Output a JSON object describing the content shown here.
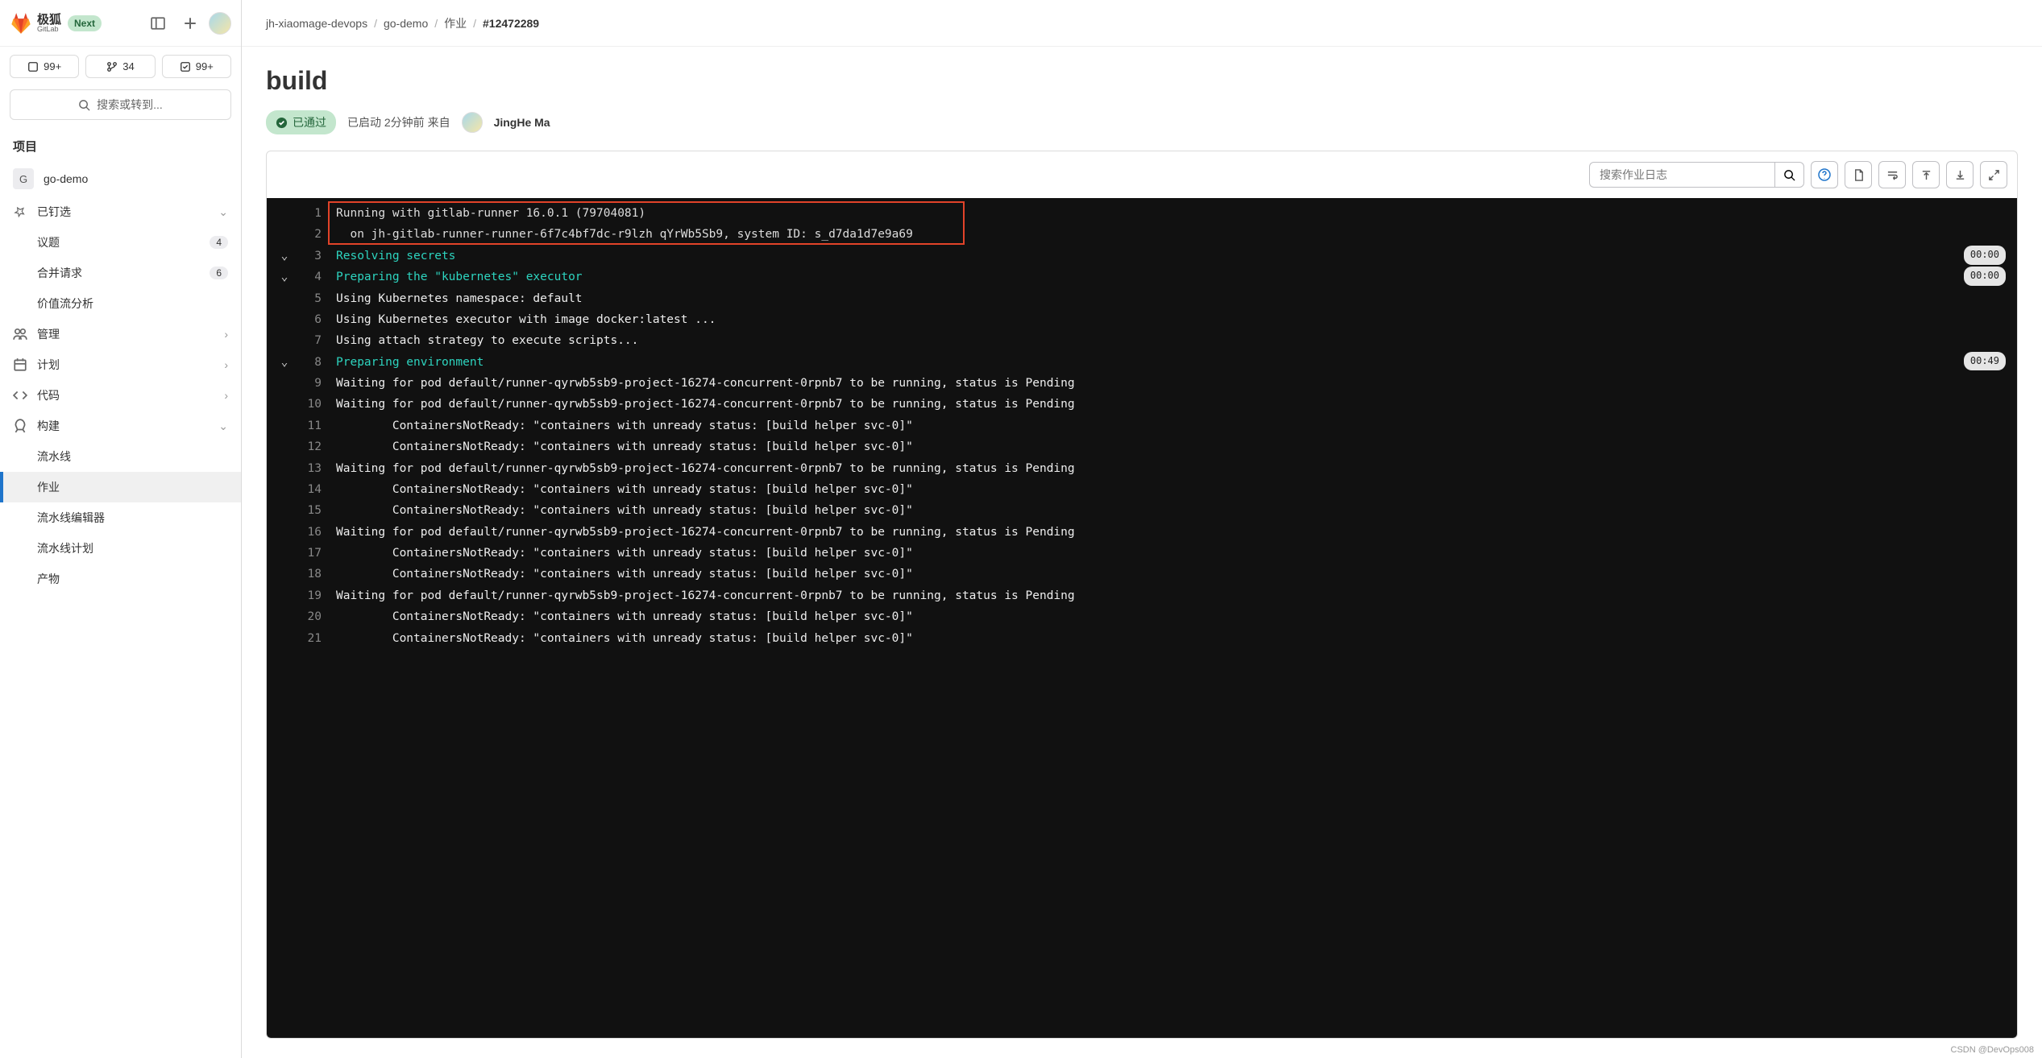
{
  "logo": {
    "main": "极狐",
    "sub": "GitLab",
    "badge": "Next"
  },
  "stats": {
    "issues": "99+",
    "merge": "34",
    "todo": "99+"
  },
  "search": {
    "placeholder": "搜索或转到..."
  },
  "sidebar": {
    "section": "项目",
    "project": {
      "initial": "G",
      "name": "go-demo"
    },
    "pinned": "已钉选",
    "items": {
      "issues": {
        "label": "议题",
        "count": "4"
      },
      "mr": {
        "label": "合并请求",
        "count": "6"
      },
      "value": {
        "label": "价值流分析"
      }
    },
    "manage": "管理",
    "plan": "计划",
    "code": "代码",
    "build": "构建",
    "build_items": {
      "pipelines": "流水线",
      "jobs": "作业",
      "editor": "流水线编辑器",
      "schedules": "流水线计划",
      "artifacts": "产物"
    }
  },
  "breadcrumb": {
    "a": "jh-xiaomage-devops",
    "b": "go-demo",
    "c": "作业",
    "d": "#12472289"
  },
  "page": {
    "title": "build",
    "status": "已通过",
    "launched": "已启动 2分钟前 来自",
    "author": "JingHe Ma"
  },
  "log_search": {
    "placeholder": "搜索作业日志"
  },
  "log": [
    {
      "n": "1",
      "type": "grey",
      "text": "Running with gitlab-runner 16.0.1 (79704081)"
    },
    {
      "n": "2",
      "type": "grey",
      "text": "  on jh-gitlab-runner-runner-6f7c4bf7dc-r9lzh qYrWb5Sb9, system ID: s_d7da1d7e9a69"
    },
    {
      "n": "3",
      "type": "cyan",
      "arrow": true,
      "text": "Resolving secrets",
      "time": "00:00"
    },
    {
      "n": "4",
      "type": "cyan",
      "arrow": true,
      "text": "Preparing the \"kubernetes\" executor",
      "time": "00:00"
    },
    {
      "n": "5",
      "type": "plain",
      "text": "Using Kubernetes namespace: default"
    },
    {
      "n": "6",
      "type": "plain",
      "text": "Using Kubernetes executor with image docker:latest ..."
    },
    {
      "n": "7",
      "type": "plain",
      "text": "Using attach strategy to execute scripts..."
    },
    {
      "n": "8",
      "type": "cyan",
      "arrow": true,
      "text": "Preparing environment",
      "time": "00:49"
    },
    {
      "n": "9",
      "type": "plain",
      "text": "Waiting for pod default/runner-qyrwb5sb9-project-16274-concurrent-0rpnb7 to be running, status is Pending"
    },
    {
      "n": "10",
      "type": "plain",
      "text": "Waiting for pod default/runner-qyrwb5sb9-project-16274-concurrent-0rpnb7 to be running, status is Pending"
    },
    {
      "n": "11",
      "type": "plain",
      "text": "        ContainersNotReady: \"containers with unready status: [build helper svc-0]\""
    },
    {
      "n": "12",
      "type": "plain",
      "text": "        ContainersNotReady: \"containers with unready status: [build helper svc-0]\""
    },
    {
      "n": "13",
      "type": "plain",
      "text": "Waiting for pod default/runner-qyrwb5sb9-project-16274-concurrent-0rpnb7 to be running, status is Pending"
    },
    {
      "n": "14",
      "type": "plain",
      "text": "        ContainersNotReady: \"containers with unready status: [build helper svc-0]\""
    },
    {
      "n": "15",
      "type": "plain",
      "text": "        ContainersNotReady: \"containers with unready status: [build helper svc-0]\""
    },
    {
      "n": "16",
      "type": "plain",
      "text": "Waiting for pod default/runner-qyrwb5sb9-project-16274-concurrent-0rpnb7 to be running, status is Pending"
    },
    {
      "n": "17",
      "type": "plain",
      "text": "        ContainersNotReady: \"containers with unready status: [build helper svc-0]\""
    },
    {
      "n": "18",
      "type": "plain",
      "text": "        ContainersNotReady: \"containers with unready status: [build helper svc-0]\""
    },
    {
      "n": "19",
      "type": "plain",
      "text": "Waiting for pod default/runner-qyrwb5sb9-project-16274-concurrent-0rpnb7 to be running, status is Pending"
    },
    {
      "n": "20",
      "type": "plain",
      "text": "        ContainersNotReady: \"containers with unready status: [build helper svc-0]\""
    },
    {
      "n": "21",
      "type": "plain",
      "text": "        ContainersNotReady: \"containers with unready status: [build helper svc-0]\""
    }
  ],
  "watermark": "CSDN @DevOps008"
}
